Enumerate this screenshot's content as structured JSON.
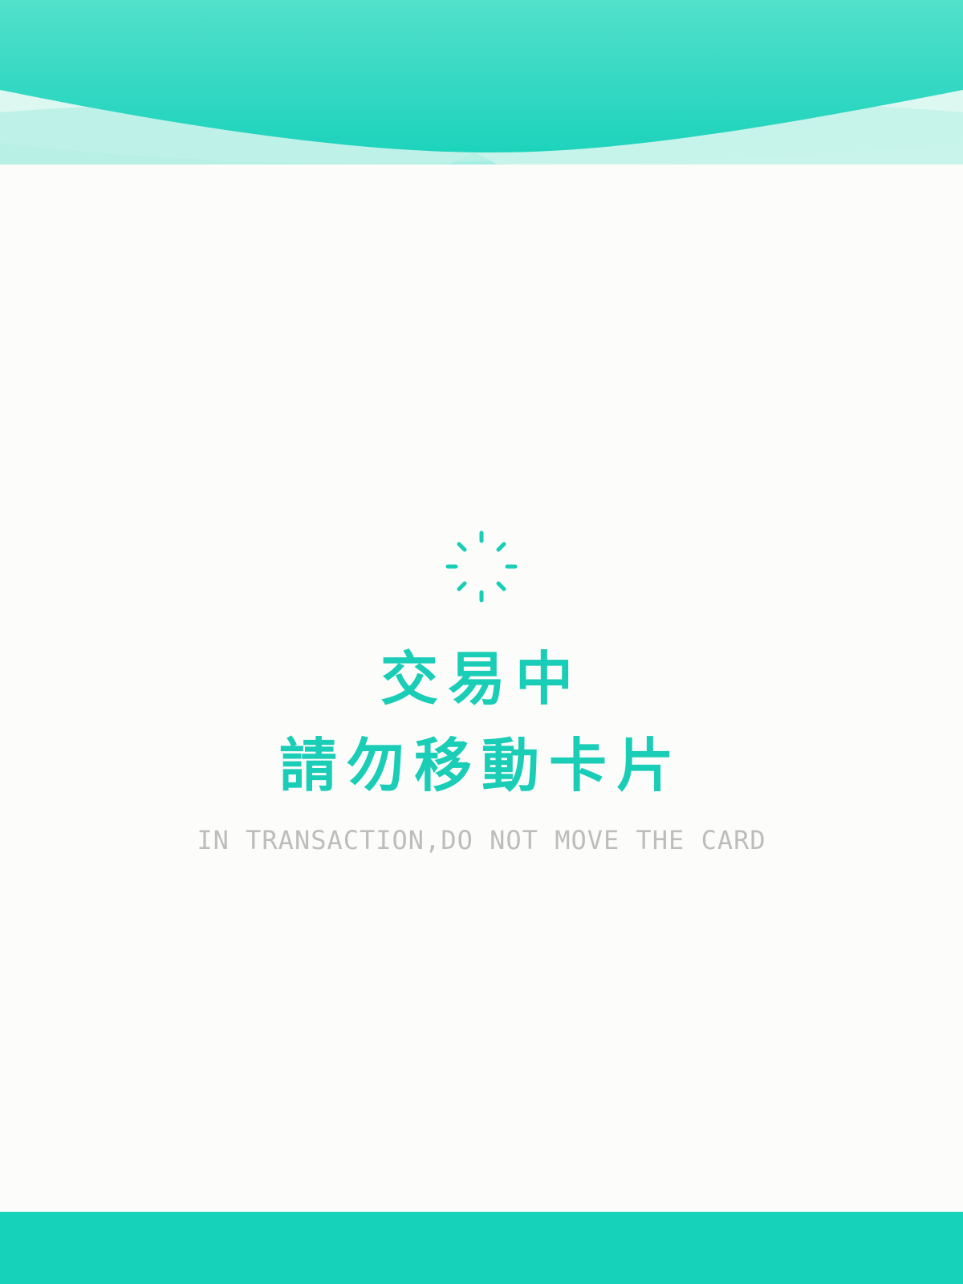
{
  "colors": {
    "accent": "#19cdb6",
    "header_top": "#52e0cb",
    "header_bottom": "#1dd3bc",
    "footer": "#16d2bb",
    "background": "#fcfcfa",
    "subtitle": "#bdbdbd"
  },
  "status": {
    "icon": "loading-spinner-icon",
    "title_line1": "交易中",
    "title_line2": "請勿移動卡片",
    "subtitle": "IN TRANSACTION,DO NOT MOVE THE CARD"
  }
}
